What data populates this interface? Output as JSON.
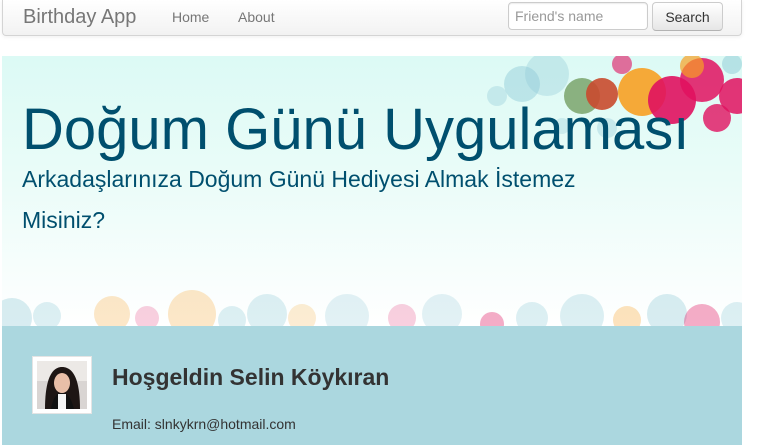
{
  "navbar": {
    "brand": "Birthday App",
    "links": [
      {
        "label": "Home"
      },
      {
        "label": "About"
      }
    ],
    "search": {
      "placeholder": "Friend's name",
      "value": "",
      "button_label": "Search"
    }
  },
  "hero": {
    "title": "Doğum Günü Uygulaması",
    "subtitle": "Arkadaşlarınıza Doğum Günü Hediyesi Almak İstemez Misiniz?"
  },
  "welcome": {
    "greeting": "Hoşgeldin Selin Köykıran",
    "email_label": "Email:",
    "email": "slnkykrn@hotmail.com"
  },
  "colors": {
    "hero_text": "#004f6e",
    "welcome_bg": "#abd7df",
    "bubble_pink": "#e0115f",
    "bubble_orange": "#f7a023",
    "bubble_blue": "#8ec9d6"
  }
}
